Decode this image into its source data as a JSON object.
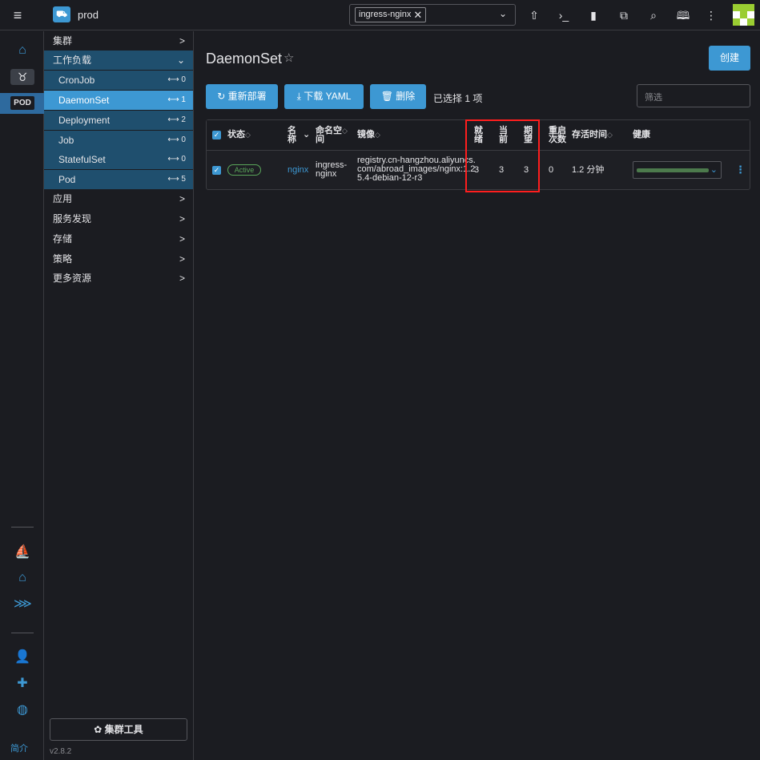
{
  "header": {
    "menu_icon": "hamburger-icon",
    "cluster_name": "prod",
    "namespace_chip": "ingress-nginx",
    "icons": [
      "upload-icon",
      "terminal-icon",
      "file-icon",
      "copy-icon",
      "search-icon",
      "book-icon",
      "more-vertical-icon"
    ]
  },
  "rail": {
    "pod_label": "POD",
    "about_label": "简介"
  },
  "nav": {
    "groups_top": [
      {
        "label": "集群",
        "chevron": ">"
      }
    ],
    "workload": {
      "label": "工作负载",
      "chevron": "⌄"
    },
    "workload_items": [
      {
        "label": "CronJob",
        "count": "⟷ 0"
      },
      {
        "label": "DaemonSet",
        "count": "⟷ 1"
      },
      {
        "label": "Deployment",
        "count": "⟷ 2"
      },
      {
        "label": "Job",
        "count": "⟷ 0"
      },
      {
        "label": "StatefulSet",
        "count": "⟷ 0"
      },
      {
        "label": "Pod",
        "count": "⟷ 5"
      }
    ],
    "groups_bottom": [
      {
        "label": "应用",
        "chevron": ">"
      },
      {
        "label": "服务发现",
        "chevron": ">"
      },
      {
        "label": "存储",
        "chevron": ">"
      },
      {
        "label": "策略",
        "chevron": ">"
      },
      {
        "label": "更多资源",
        "chevron": ">"
      }
    ],
    "cluster_tools": "✿ 集群工具",
    "version": "v2.8.2"
  },
  "main": {
    "title": "DaemonSet",
    "create_label": "创建",
    "redeploy_label": "↻ 重新部署",
    "download_label": "⤓ 下载 YAML",
    "delete_label": "🗑 删除",
    "selected_text": "已选择 1 项",
    "filter_placeholder": "筛选"
  },
  "table": {
    "headers": {
      "status": "状态",
      "name_1": "名",
      "name_2": "称",
      "namespace_1": "命名空",
      "namespace_2": "间",
      "image": "镜像",
      "ready_1": "就",
      "ready_2": "绪",
      "current_1": "当",
      "current_2": "前",
      "desired_1": "期",
      "desired_2": "望",
      "restarts_1": "重启",
      "restarts_2": "次数",
      "age": "存活时间",
      "health": "健康"
    },
    "row": {
      "status": "Active",
      "name": "nginx",
      "namespace_1": "ingress-",
      "namespace_2": "nginx",
      "image_1": "registry.cn-hangzhou.aliyuncs.",
      "image_2": "com/abroad_images/nginx:1.2",
      "image_3": "5.4-debian-12-r3",
      "ready": "3",
      "current": "3",
      "desired": "3",
      "restarts": "0",
      "age": "1.2 分钟"
    }
  }
}
